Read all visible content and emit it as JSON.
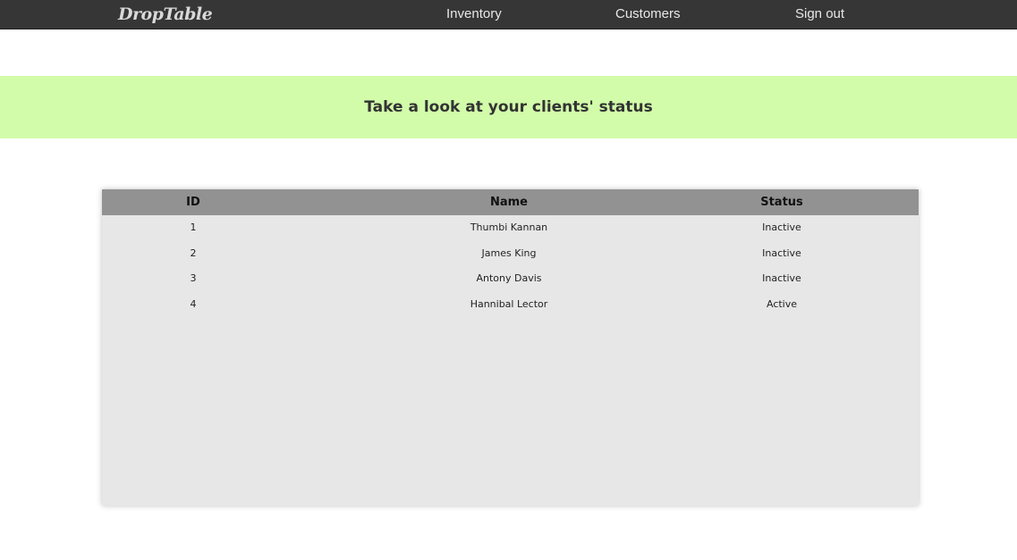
{
  "navbar": {
    "brand": "DropTable",
    "links": [
      "Inventory",
      "Customers",
      "Sign out"
    ]
  },
  "banner": {
    "title": "Take a look at your clients' status"
  },
  "table": {
    "headers": [
      "ID",
      "Name",
      "Status"
    ],
    "rows": [
      {
        "id": "1",
        "name": "Thumbi Kannan",
        "status": "Inactive"
      },
      {
        "id": "2",
        "name": "James King",
        "status": "Inactive"
      },
      {
        "id": "3",
        "name": "Antony Davis",
        "status": "Inactive"
      },
      {
        "id": "4",
        "name": "Hannibal Lector",
        "status": "Active"
      }
    ]
  },
  "colors": {
    "navbar_bg": "#363636",
    "banner_bg": "#d2fcaa",
    "table_header_bg": "#929292",
    "table_body_bg": "#e7e7e7"
  }
}
